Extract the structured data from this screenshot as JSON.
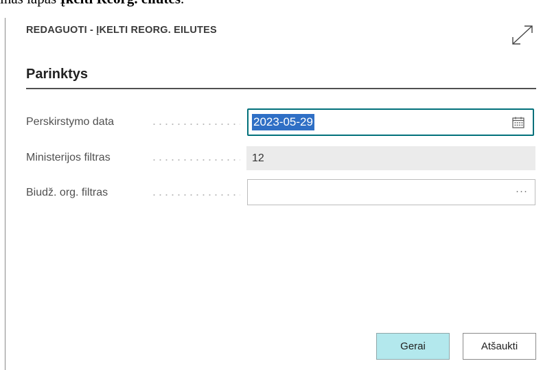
{
  "doc_text": {
    "prefix": "inas lapas ",
    "bold": "Įkelti Reorg. eilutes",
    "suffix": "."
  },
  "dialog": {
    "title": "REDAGUOTI - ĮKELTI REORG. EILUTES",
    "expand_icon": "expand-diagonal-icon",
    "section_title": "Parinktys"
  },
  "fields": {
    "date": {
      "label": "Perskirstymo data",
      "value": "2023-05-29",
      "icon": "calendar-icon"
    },
    "ministry": {
      "label": "Ministerijos filtras",
      "value": "12"
    },
    "budget_org": {
      "label": "Biudž. org. filtras",
      "value": "",
      "action": "···"
    }
  },
  "buttons": {
    "ok": "Gerai",
    "cancel": "Atšaukti"
  },
  "colors": {
    "accent": "#00707a",
    "selection": "#2f6fc5",
    "primary_button": "#b3e8ed",
    "readonly_bg": "#ebebeb"
  }
}
